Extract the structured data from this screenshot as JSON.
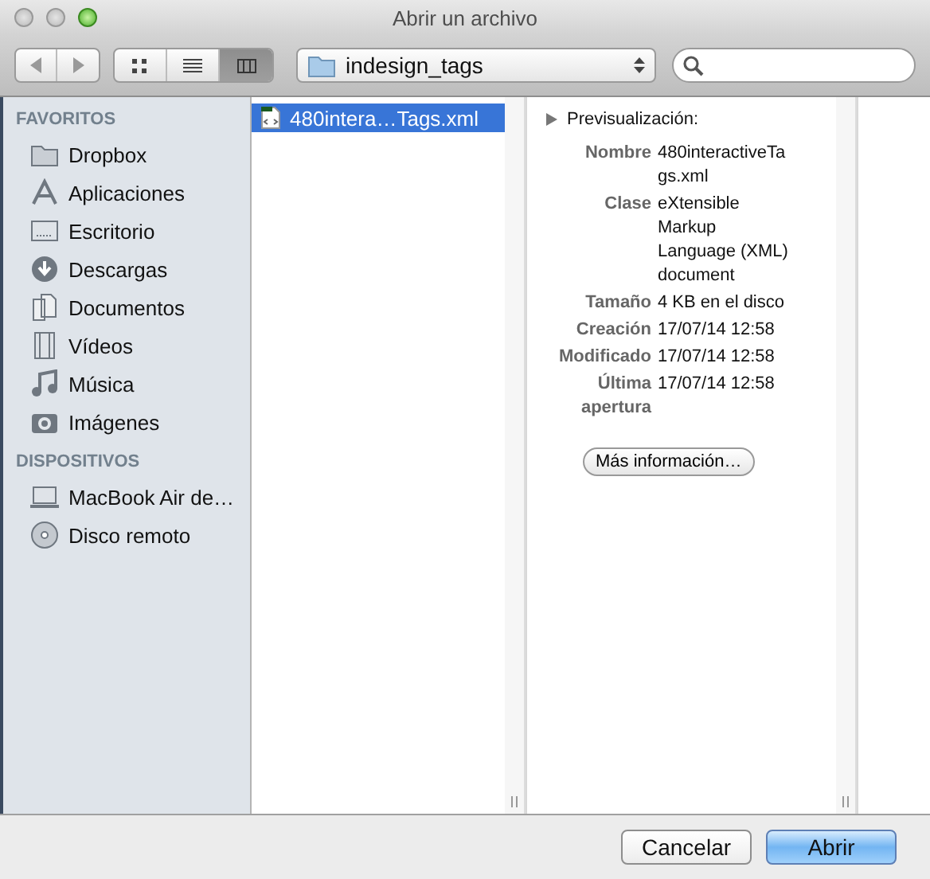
{
  "window": {
    "title": "Abrir un archivo"
  },
  "toolbar": {
    "view_modes": [
      {
        "kind": "icons",
        "selected": false
      },
      {
        "kind": "list",
        "selected": false
      },
      {
        "kind": "columns",
        "selected": true
      }
    ],
    "location": "indesign_tags"
  },
  "sidebar": {
    "sections": [
      {
        "heading": "FAVORITOS",
        "items": [
          {
            "label": "Dropbox",
            "kind": "folder"
          },
          {
            "label": "Aplicaciones",
            "kind": "apps"
          },
          {
            "label": "Escritorio",
            "kind": "desktop"
          },
          {
            "label": "Descargas",
            "kind": "download"
          },
          {
            "label": "Documentos",
            "kind": "documents"
          },
          {
            "label": "Vídeos",
            "kind": "movies"
          },
          {
            "label": "Música",
            "kind": "music"
          },
          {
            "label": "Imágenes",
            "kind": "pictures"
          }
        ]
      },
      {
        "heading": "DISPOSITIVOS",
        "items": [
          {
            "label": "MacBook Air de…",
            "kind": "laptop"
          },
          {
            "label": "Disco remoto",
            "kind": "disc"
          }
        ]
      }
    ]
  },
  "files": [
    {
      "name": "480intera…Tags.xml",
      "selected": true
    }
  ],
  "preview": {
    "toggle": "Previsualización:",
    "fields": [
      {
        "label": "Nombre",
        "value": "480interactiveTags.xml"
      },
      {
        "label": "Clase",
        "value": "eXtensible Markup Language (XML) document"
      },
      {
        "label": "Tamaño",
        "value": "4 KB en el disco"
      },
      {
        "label": "Creación",
        "value": "17/07/14 12:58"
      },
      {
        "label": "Modificado",
        "value": "17/07/14 12:58"
      },
      {
        "label": "Última apertura",
        "value": "17/07/14 12:58"
      }
    ],
    "more_button": "Más información…"
  },
  "buttons": [
    {
      "label": "Cancelar",
      "default": false
    },
    {
      "label": "Abrir",
      "default": true
    }
  ]
}
